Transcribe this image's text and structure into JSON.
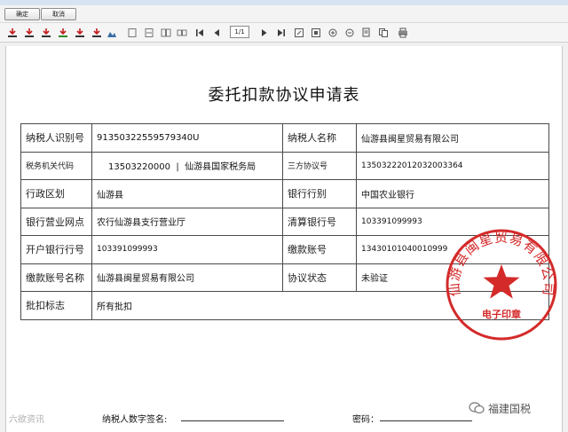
{
  "dialog": {
    "confirm_label": "确定",
    "cancel_label": "取消"
  },
  "toolbar": {
    "page_indicator": "1/1"
  },
  "document": {
    "title": "委托扣款协议申请表",
    "rows": [
      {
        "l1": "纳税人识别号",
        "v1": "91350322559579340U",
        "l2": "纳税人名称",
        "v2": "仙游县闽星贸易有限公司"
      },
      {
        "l1": "税务机关代码",
        "v1": "13503220000  |  仙游县国家税务局",
        "l2": "三方协议号",
        "v2": "13503222012032003364"
      },
      {
        "l1": "行政区划",
        "v1": "仙游县",
        "l2": "银行行别",
        "v2": "中国农业银行"
      },
      {
        "l1": "银行营业网点",
        "v1": "农行仙游县支行营业厅",
        "l2": "清算银行号",
        "v2": "103391099993"
      },
      {
        "l1": "开户银行行号",
        "v1": "103391099993",
        "l2": "缴款账号",
        "v2": "13430101040010999"
      },
      {
        "l1": "缴款账号名称",
        "v1": "仙游县闽星贸易有限公司",
        "l2": "协议状态",
        "v2": "未验证"
      },
      {
        "l1": "批扣标志",
        "v1": "所有批扣"
      }
    ],
    "signature_label": "纳税人数字签名:",
    "password_label": "密码："
  },
  "seal": {
    "arc_text": "仙游县闽星贸易有限公司",
    "center_text": "电子印章",
    "color": "#d42a2a"
  },
  "watermark": {
    "left_text": "六欲资讯",
    "brand_text": "福建国税"
  }
}
